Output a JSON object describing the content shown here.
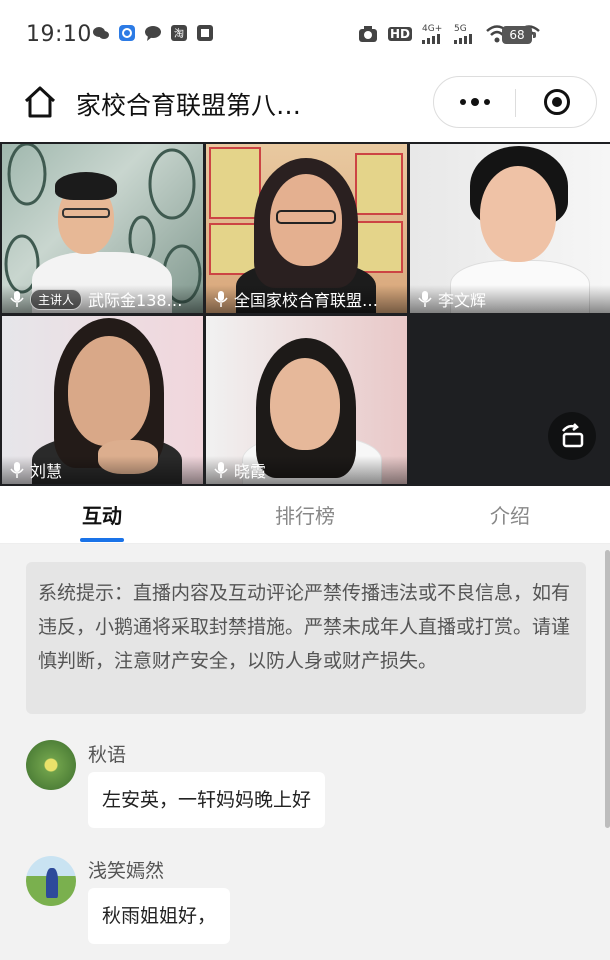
{
  "status_bar": {
    "time": "19:10",
    "network_labels": [
      "HD",
      "4G+",
      "5G"
    ],
    "battery": "68"
  },
  "title_bar": {
    "title": "家校合育联盟第八…",
    "home_icon": "home-icon",
    "more_icon": "more-dots-icon",
    "close_icon": "close-miniprogram-icon"
  },
  "video_tiles": [
    {
      "name": "武际金138…",
      "badge": "主讲人"
    },
    {
      "name": "全国家校合育联盟…"
    },
    {
      "name": "李文辉"
    },
    {
      "name": "刘慧"
    },
    {
      "name": "晓霞"
    }
  ],
  "tabs": [
    {
      "label": "互动",
      "active": true
    },
    {
      "label": "排行榜",
      "active": false
    },
    {
      "label": "介绍",
      "active": false
    }
  ],
  "system_notice": "系统提示：直播内容及互动评论严禁传播违法或不良信息，如有违反，小鹅通将采取封禁措施。严禁未成年人直播或打赏。请谨慎判断，注意财产安全，以防人身或财产损失。",
  "messages": [
    {
      "user": "秋语",
      "text": "左安英，一轩妈妈晚上好"
    },
    {
      "user": "浅笑嫣然",
      "text": "秋雨姐姐好，"
    }
  ],
  "colors": {
    "accent": "#1a73e8",
    "chat_bg": "#f2f2f2",
    "notice_bg": "#e5e5e5"
  }
}
